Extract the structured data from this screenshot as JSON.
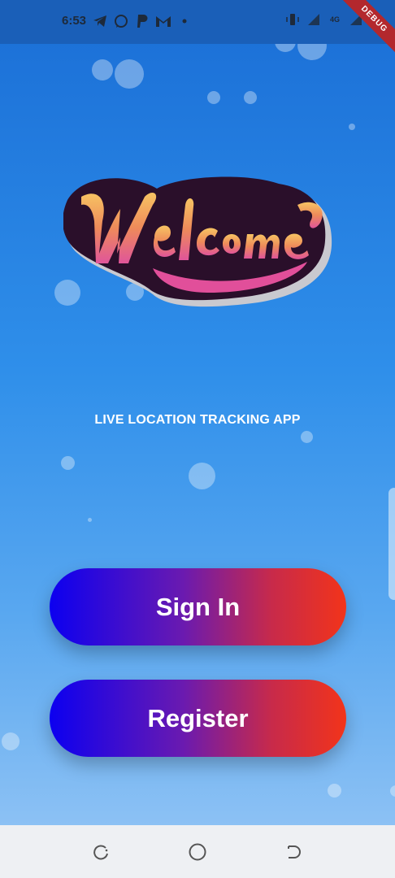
{
  "status_bar": {
    "time": "6:53",
    "left_icons": [
      "telegram-icon",
      "whatsapp-icon",
      "paypal-icon",
      "gmail-icon",
      "dot-icon"
    ],
    "right_icons": [
      "vibrate-icon",
      "signal-icon",
      "network-4g-icon",
      "signal-icon-2",
      "battery-icon"
    ],
    "network_label": "4G",
    "debug_label": "DEBUG"
  },
  "logo": {
    "text": "Welcome"
  },
  "subtitle": "LIVE LOCATION TRACKING APP",
  "buttons": {
    "sign_in": "Sign In",
    "register": "Register"
  },
  "colors": {
    "background_top": "#1a6ed6",
    "background_bottom": "#8cc1f4",
    "button_gradient_start": "#0c00f0",
    "button_gradient_end": "#f2341a"
  },
  "nav_bar": {
    "icons": [
      "recent-apps-icon",
      "home-icon",
      "back-icon"
    ]
  }
}
